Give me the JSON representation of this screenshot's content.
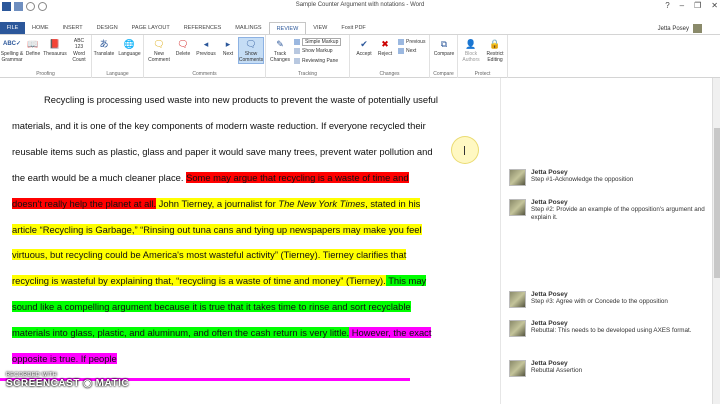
{
  "window": {
    "title": "Sample Counter Argument with notations - Word",
    "controls": [
      "?",
      "–",
      "❐",
      "✕"
    ]
  },
  "tabs": [
    "FILE",
    "HOME",
    "INSERT",
    "DESIGN",
    "PAGE LAYOUT",
    "REFERENCES",
    "MAILINGS",
    "REVIEW",
    "VIEW",
    "Foxit PDF"
  ],
  "active_tab": "REVIEW",
  "user": {
    "name": "Jetta Posey"
  },
  "ribbon": {
    "proofing": {
      "label": "Proofing",
      "spelling": "Spelling &\nGrammar",
      "define": "Define",
      "thesaurus": "Thesaurus",
      "word_count": "Word\nCount"
    },
    "language": {
      "label": "Language",
      "translate": "Translate",
      "language": "Language"
    },
    "comments": {
      "label": "Comments",
      "new": "New\nComment",
      "delete": "Delete",
      "previous": "Previous",
      "next": "Next",
      "show": "Show\nComments"
    },
    "tracking": {
      "label": "Tracking",
      "track_changes": "Track\nChanges",
      "simple_markup": "Simple Markup",
      "show_markup": "Show Markup",
      "reviewing_pane": "Reviewing Pane"
    },
    "changes": {
      "label": "Changes",
      "accept": "Accept",
      "reject": "Reject",
      "previous": "Previous",
      "next": "Next"
    },
    "compare": {
      "label": "Compare",
      "compare": "Compare"
    },
    "protect": {
      "label": "Protect",
      "block_authors": "Block\nAuthors",
      "restrict_editing": "Restrict\nEditing"
    }
  },
  "document": {
    "p1_plain": "Recycling is processing used waste into new products to prevent the waste of potentially useful materials, and it is one of the key components of modern waste reduction. If everyone recycled their reusable items such as plastic, glass and paper it would save many trees, prevent water pollution and the earth would be a much cleaner place. ",
    "p1_red": "Some may argue that recycling is a waste of time and doesn't really help the planet at all.",
    "p1_yellow_a": " John Tierney, a journalist for ",
    "p1_yellow_italic": "The New York Times",
    "p1_yellow_b": ", stated in his article “Recycling is Garbage,” “Rinsing out tuna cans and tying up newspapers may make you feel virtuous, but recycling could be America's most wasteful activity” (Tierney). Tierney clarifies that recycling is wasteful by explaining that, “recycling is a waste of time and money” (Tierney).",
    "p1_green": " This may sound like a compelling argument because it is true that it takes time to rinse and sort recyclable materials into glass, plastic, and aluminum, and often the cash return is very little.",
    "p1_magenta": " However, the exact opposite is true. If people"
  },
  "comments": [
    {
      "author": "Jetta Posey",
      "text": "Step #1-Acknowledge the opposition"
    },
    {
      "author": "Jetta Posey",
      "text": "Step #2: Provide an example of the opposition's argument and explain it."
    },
    {
      "author": "Jetta Posey",
      "text": "Step #3: Agree with or Concede to the opposition"
    },
    {
      "author": "Jetta Posey",
      "text": "Rebuttal: This needs to be developed using AXES format."
    },
    {
      "author": "Jetta Posey",
      "text": "Rebuttal Assertion"
    }
  ],
  "watermark": {
    "recorded": "RECORDED WITH",
    "brand": "SCREENCAST ◉ MATIC"
  },
  "colors": {
    "word_blue": "#2b579a",
    "highlight_red": "#ff0000",
    "highlight_yellow": "#ffff00",
    "highlight_green": "#00ff00",
    "highlight_magenta": "#ff00ff"
  }
}
